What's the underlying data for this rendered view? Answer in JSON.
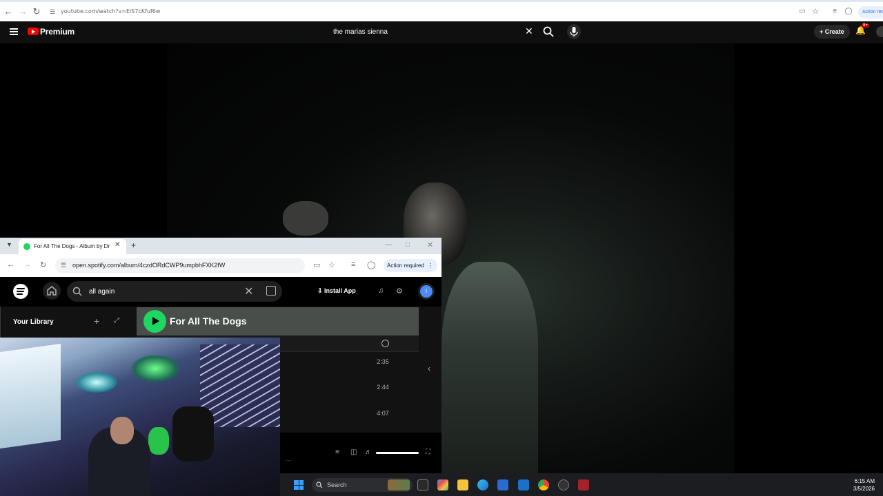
{
  "top_browser": {
    "url": "youtube.com/watch?v=EiS7cKfuf6w",
    "action_required": "Action requ"
  },
  "youtube": {
    "brand": "Premium",
    "search_query": "the marias sienna",
    "create_label": "Create",
    "notification_badge": "9+"
  },
  "spotify_window": {
    "tab_title": "For All The Dogs - Album by Dr",
    "url": "open.spotify.com/album/4czdORdCWP9umpbhFXK2fW",
    "action_required": "Action required",
    "search_value": "all again",
    "install_app": "Install App",
    "avatar_initial": "I",
    "library_title": "Your Library",
    "album_title": "For All The Dogs",
    "track_durations": [
      "2:35",
      "2:44",
      "4:07"
    ],
    "elapsed": "-:--",
    "volume_fraction": 1.0
  },
  "taskbar": {
    "search_placeholder": "Search",
    "time": "6:15 AM",
    "date": "3/5/2026"
  },
  "colors": {
    "youtube_red": "#ff0000",
    "spotify_green": "#1ed760",
    "taskbar_bg": "#1b1d21"
  }
}
